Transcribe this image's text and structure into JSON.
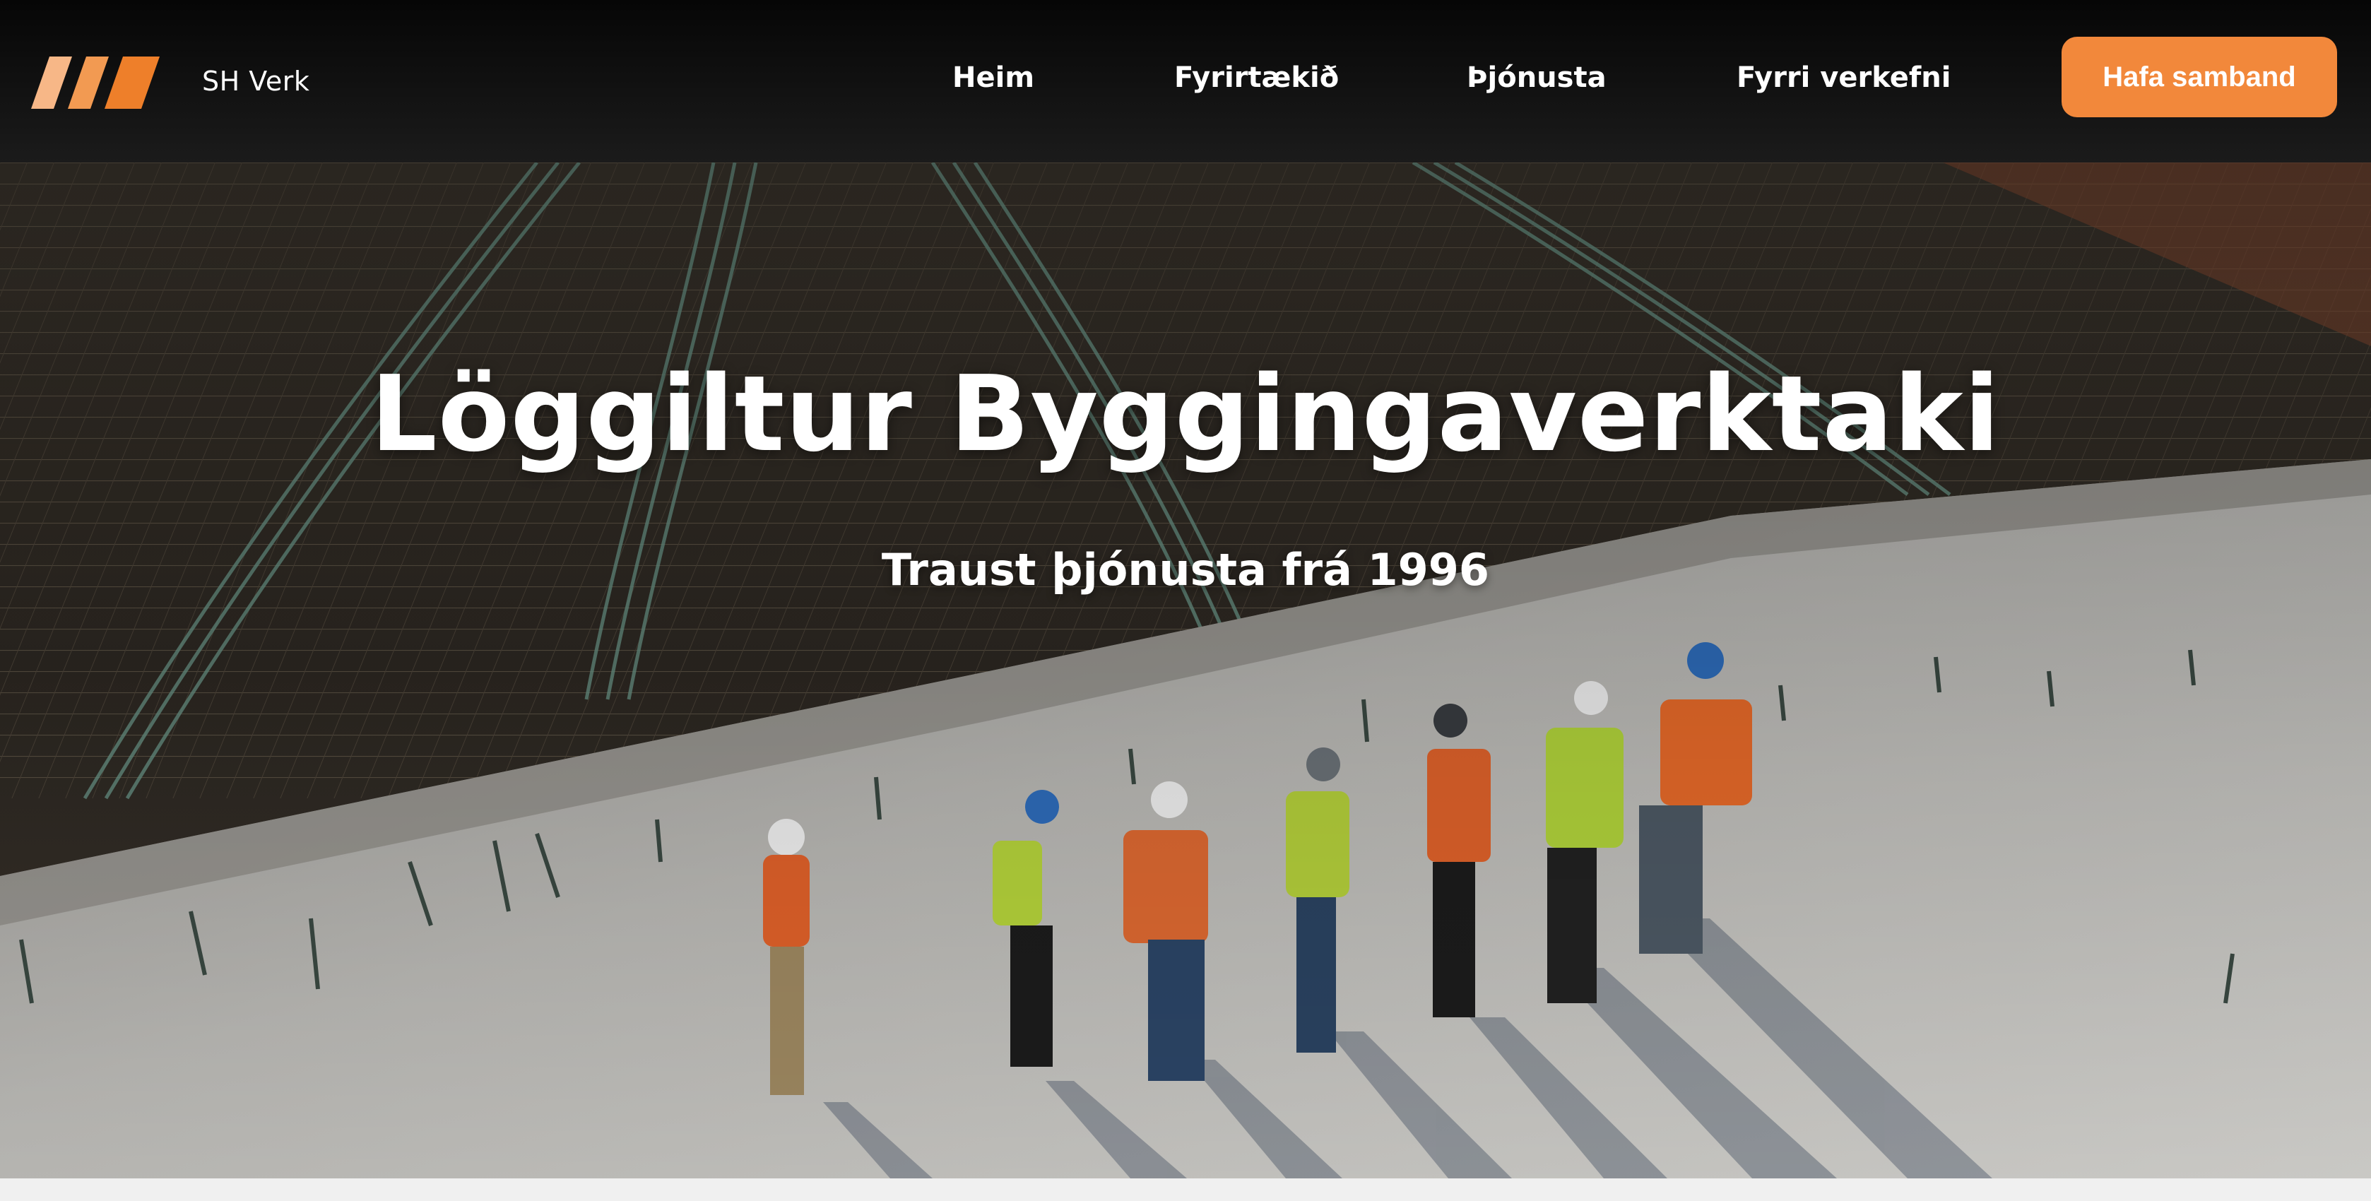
{
  "brand": {
    "name": "SH Verk",
    "logo_icon": "three-slanted-stripes-logo",
    "logo_colors": [
      "#f7b787",
      "#f29a52",
      "#ee7f2a"
    ]
  },
  "nav": {
    "items": [
      {
        "label": "Heim"
      },
      {
        "label": "Fyrirtækið"
      },
      {
        "label": "Þjónusta"
      },
      {
        "label": "Fyrri verkefni"
      }
    ],
    "cta_label": "Hafa samband"
  },
  "hero": {
    "title": "Löggiltur Byggingaverktaki",
    "subtitle": "Traust þjónusta frá 1996",
    "image": "construction-site-workers-photo"
  },
  "colors": {
    "accent": "#f2883b",
    "nav_background": "#111111",
    "text": "#ffffff"
  }
}
